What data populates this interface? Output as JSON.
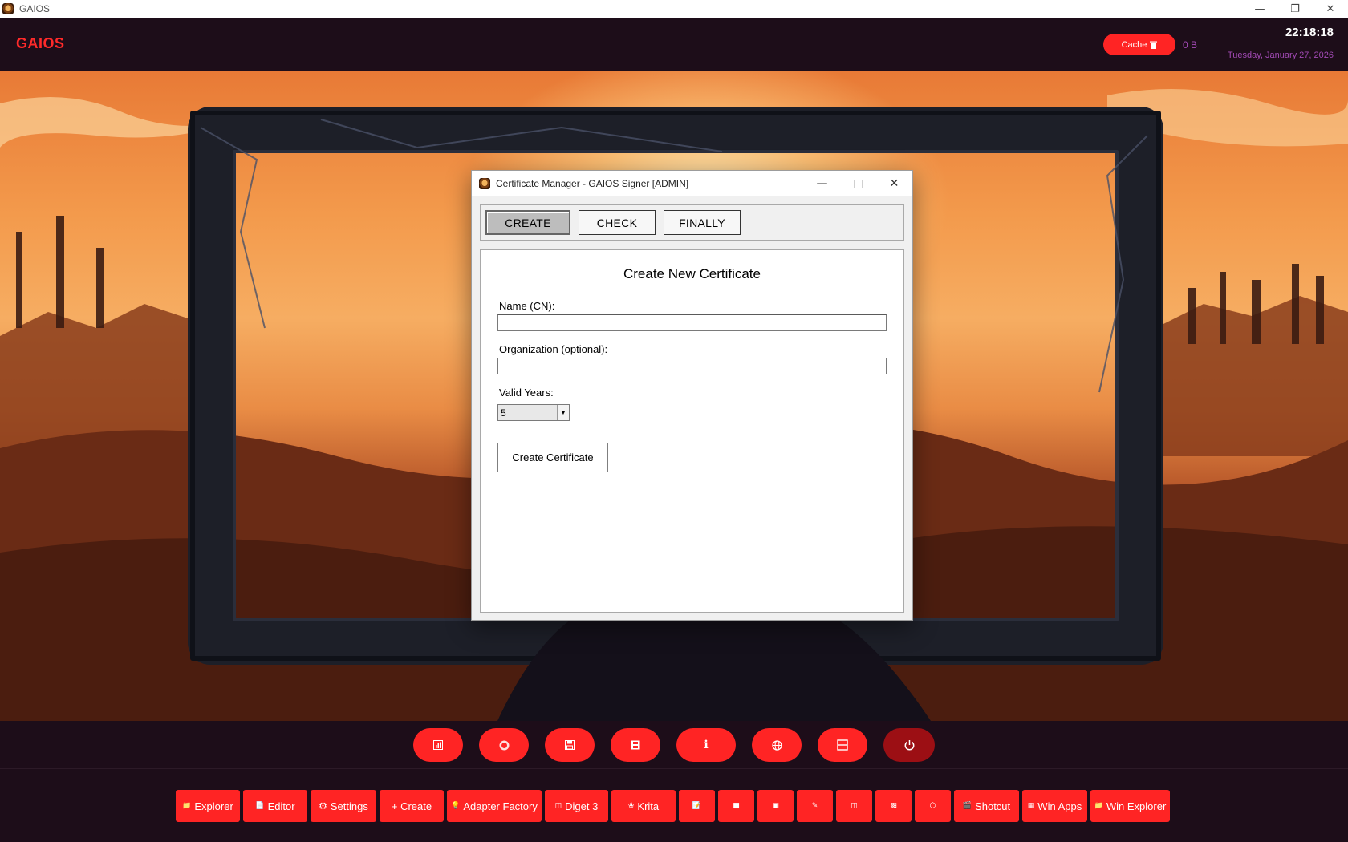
{
  "os": {
    "title": "GAIOS",
    "icons": {
      "app": "lion-app-icon",
      "minimize": "minimize-icon",
      "restore": "restore-icon",
      "close": "close-icon"
    }
  },
  "header": {
    "brand": "GAIOS",
    "cache_label": "Cache",
    "cache_icon": "trash-icon",
    "cache_size": "0 B",
    "time": "22:18:18",
    "date": "Tuesday, January 27, 2026"
  },
  "dialog": {
    "title": "Certificate Manager - GAIOS Signer [ADMIN]",
    "tabs": [
      {
        "label": "CREATE",
        "active": true
      },
      {
        "label": "CHECK",
        "active": false
      },
      {
        "label": "FINALLY",
        "active": false
      }
    ],
    "panel": {
      "heading": "Create New Certificate",
      "name_label": "Name (CN):",
      "name_value": "",
      "org_label": "Organization (optional):",
      "org_value": "",
      "years_label": "Valid Years:",
      "years_value": "5",
      "submit_label": "Create Certificate"
    }
  },
  "dock": {
    "buttons": [
      {
        "icon": "chart-icon"
      },
      {
        "icon": "record-icon"
      },
      {
        "icon": "save-icon"
      },
      {
        "icon": "disk-icon"
      },
      {
        "icon": "info-icon",
        "label": "i"
      },
      {
        "icon": "globe-icon"
      },
      {
        "icon": "layout-icon"
      },
      {
        "icon": "power-icon"
      }
    ]
  },
  "taskbar": {
    "items": [
      {
        "label": "Explorer",
        "icon": "folder-icon"
      },
      {
        "label": "Editor",
        "icon": "document-icon"
      },
      {
        "label": "Settings",
        "icon": "gear-icon"
      },
      {
        "label": "+ Create",
        "icon": ""
      },
      {
        "label": "Adapter Factory",
        "icon": "bulb-icon"
      },
      {
        "label": "Diget 3",
        "icon": "frame-icon"
      },
      {
        "label": "Krita",
        "icon": "brush-icon"
      },
      {
        "label": "",
        "icon": "note-icon"
      },
      {
        "label": "",
        "icon": "disk-icon"
      },
      {
        "label": "",
        "icon": "package-icon"
      },
      {
        "label": "",
        "icon": "pen-icon"
      },
      {
        "label": "",
        "icon": "trash-icon"
      },
      {
        "label": "",
        "icon": "frame-icon"
      },
      {
        "label": "",
        "icon": "cube-icon"
      },
      {
        "label": "Shotcut",
        "icon": "clapper-icon"
      },
      {
        "label": "Win Apps",
        "icon": "window-icon"
      },
      {
        "label": "Win Explorer",
        "icon": "folder-icon"
      }
    ]
  }
}
